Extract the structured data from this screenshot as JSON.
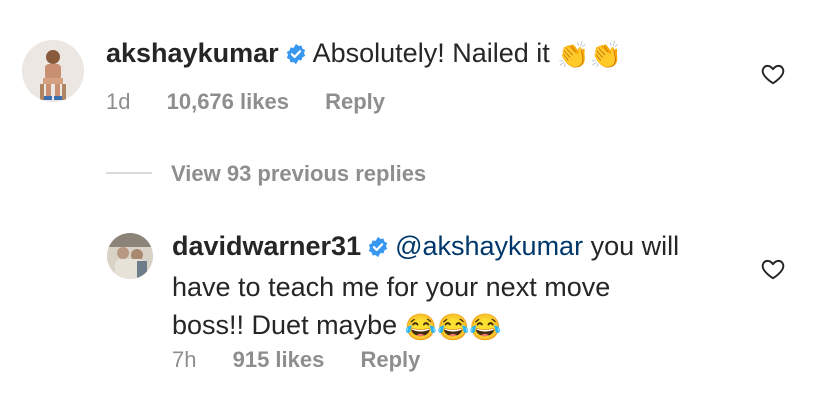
{
  "comment1": {
    "username": "akshaykumar",
    "text": "Absolutely! Nailed it",
    "emoji": "👏👏",
    "time": "1d",
    "likes": "10,676 likes",
    "reply_label": "Reply"
  },
  "thread": {
    "view_previous_label": "View 93 previous replies"
  },
  "comment2": {
    "username": "davidwarner31",
    "mention": "@akshaykumar",
    "line1_rest": "you will",
    "line2": "have to teach me for your next move",
    "line3": "boss!! Duet maybe",
    "emoji": "😂😂😂",
    "time": "7h",
    "likes": "915 likes",
    "reply_label": "Reply"
  },
  "colors": {
    "verified_blue": "#3897f0",
    "mention": "#00376b",
    "meta_gray": "#8e8e8e"
  },
  "icons": {
    "like": "heart-outline-icon",
    "verified": "verified-badge-icon"
  }
}
